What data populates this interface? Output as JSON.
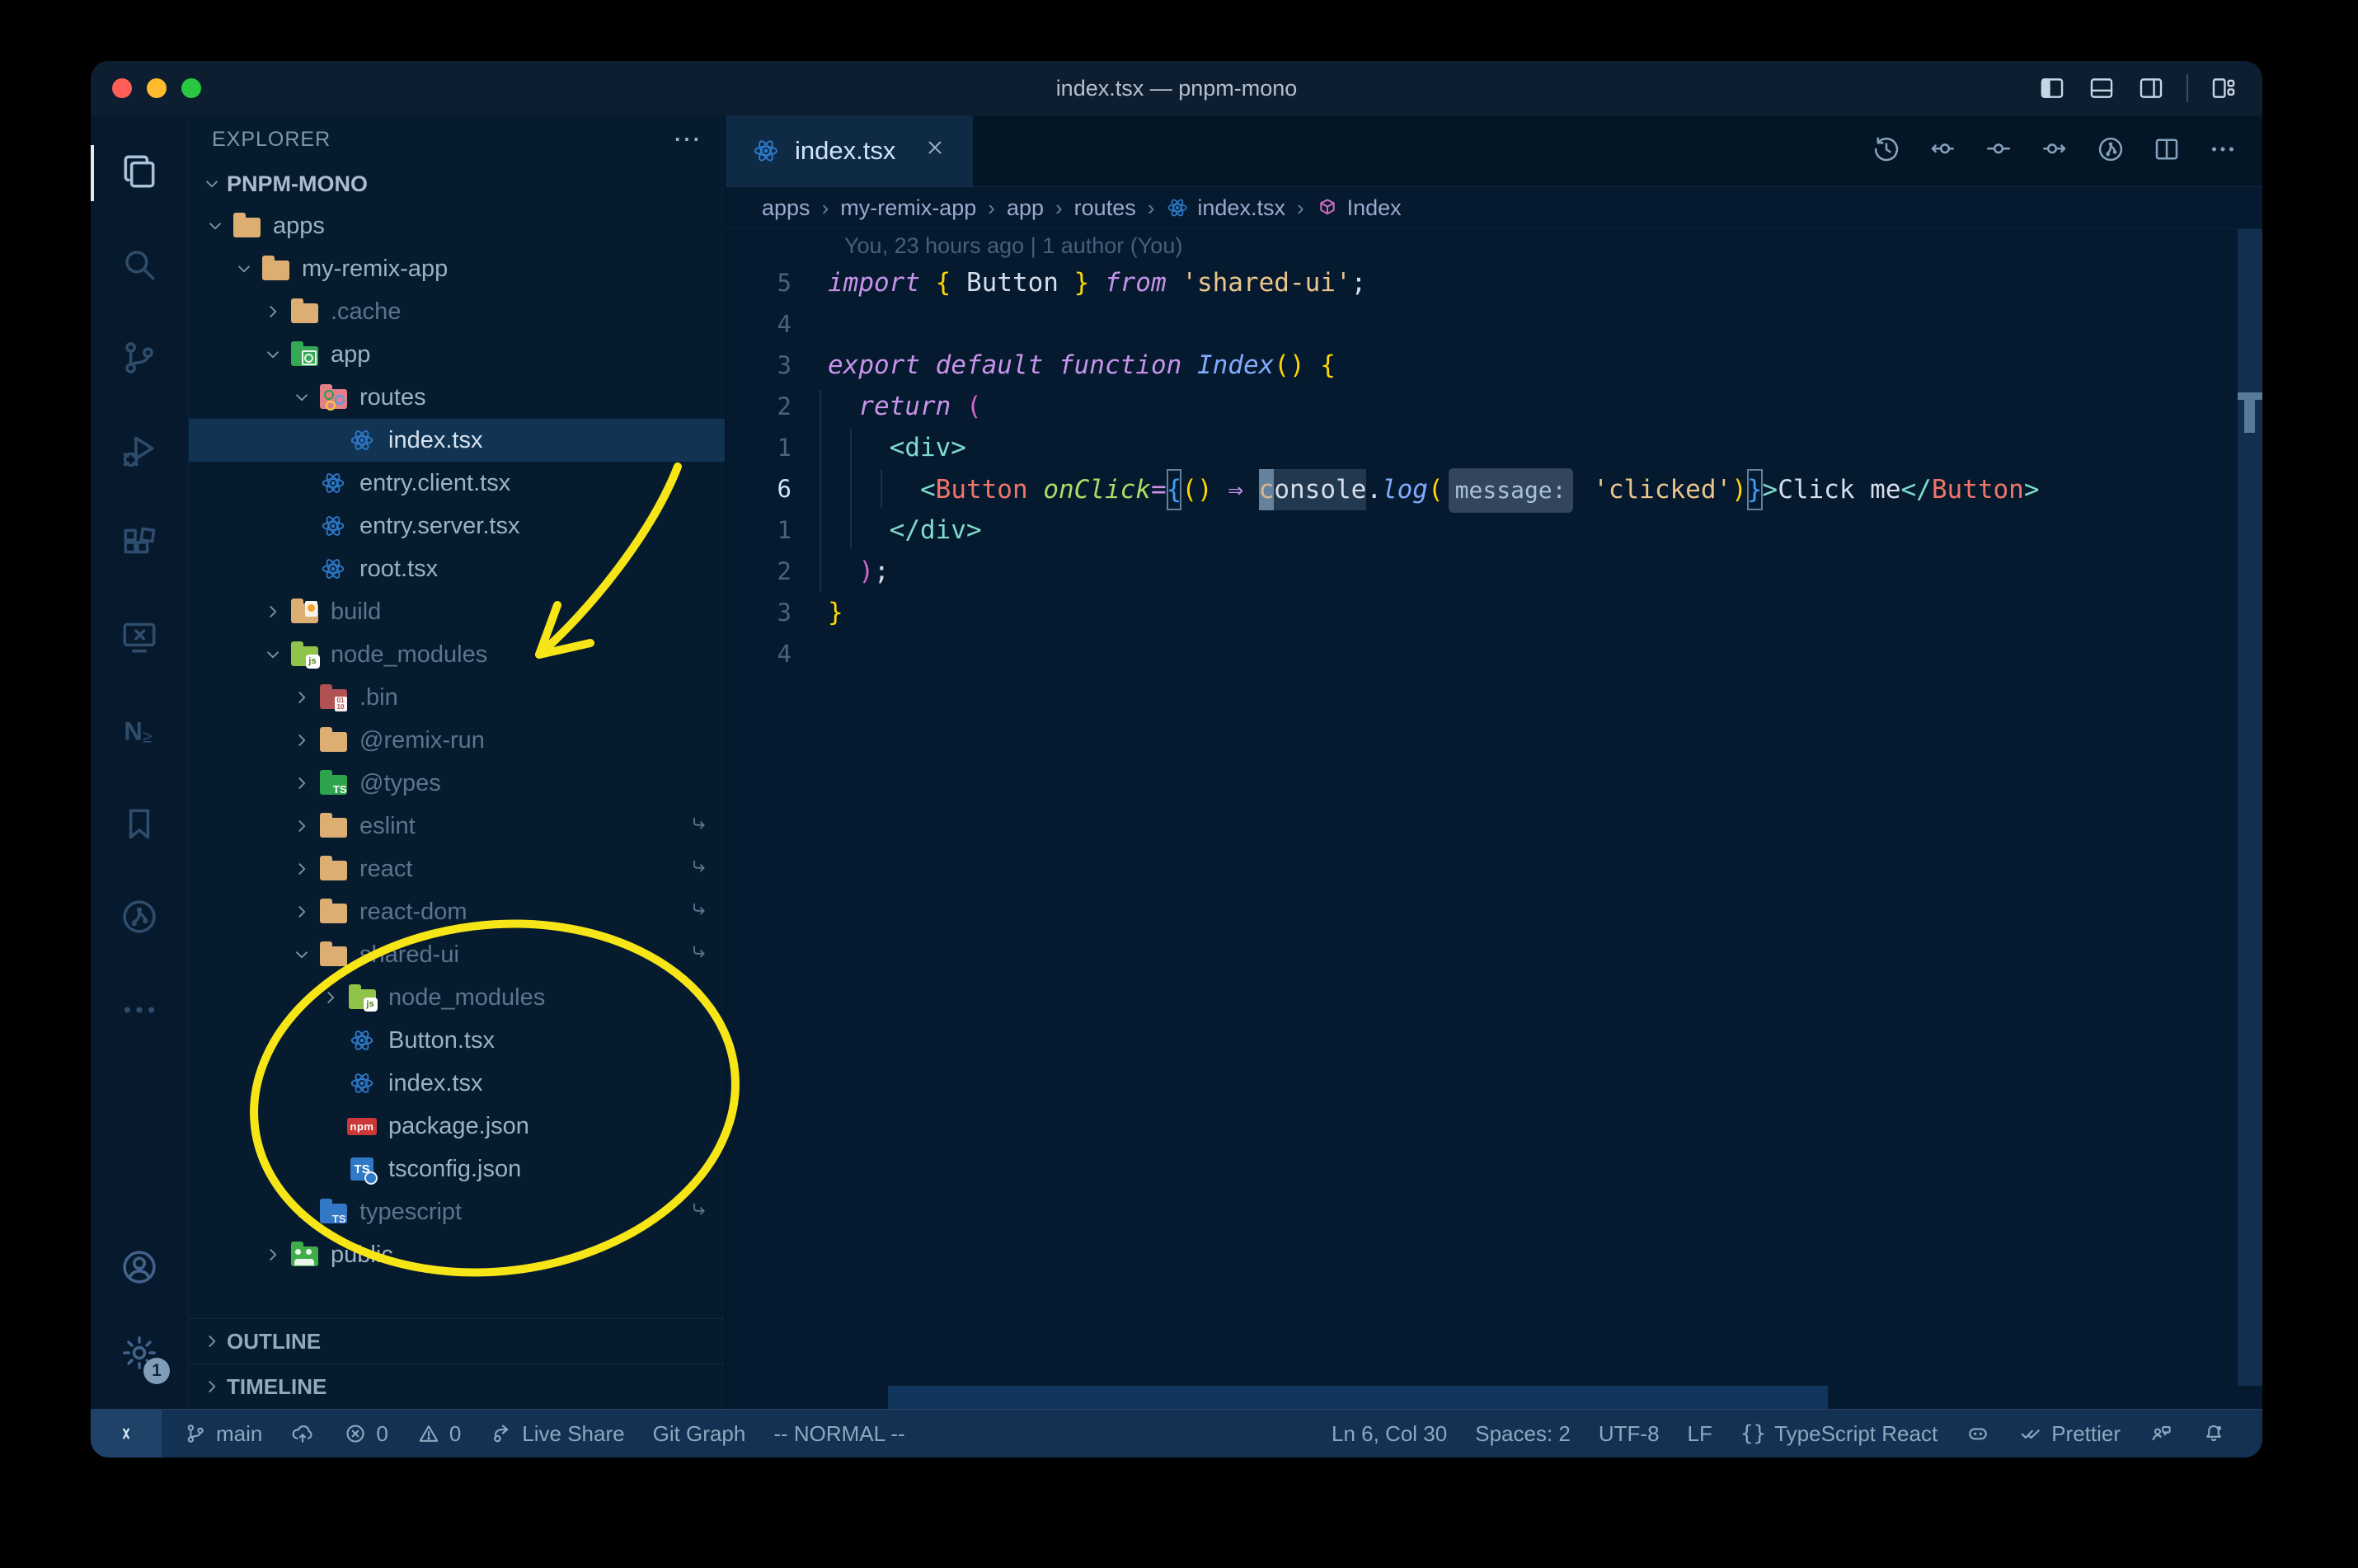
{
  "window": {
    "title": "index.tsx — pnpm-mono"
  },
  "titlebar": {
    "layout_icons": [
      "layout-sidebar-left",
      "layout-panel-bottom",
      "layout-sidebar-right",
      "layout-customize"
    ]
  },
  "activity_bar": {
    "items": [
      {
        "name": "explorer",
        "icon": "files",
        "active": true
      },
      {
        "name": "search",
        "icon": "search",
        "active": false
      },
      {
        "name": "source-control",
        "icon": "scm",
        "active": false
      },
      {
        "name": "run-debug",
        "icon": "debug",
        "active": false
      },
      {
        "name": "extensions",
        "icon": "extensions",
        "active": false
      },
      {
        "name": "remote-explorer",
        "icon": "remote",
        "active": false
      },
      {
        "name": "nx-console",
        "icon": "nx",
        "active": false
      },
      {
        "name": "bookmarks",
        "icon": "bookmark",
        "active": false
      },
      {
        "name": "git-graph",
        "icon": "gitgraph",
        "active": false
      },
      {
        "name": "more-views",
        "icon": "more",
        "active": false
      }
    ],
    "bottom": [
      {
        "name": "account",
        "icon": "account"
      },
      {
        "name": "settings",
        "icon": "gear",
        "badge": "1"
      }
    ]
  },
  "sidebar": {
    "header": "EXPLORER",
    "header_more": "⋯",
    "section": "PNPM-MONO",
    "tree": [
      {
        "label": "apps",
        "level": 1,
        "chevron": "down",
        "icon": "folder-tan",
        "dim": false
      },
      {
        "label": "my-remix-app",
        "level": 2,
        "chevron": "down",
        "icon": "folder-tan",
        "dim": false
      },
      {
        "label": ".cache",
        "level": 3,
        "chevron": "right",
        "icon": "folder-tan",
        "dim": true
      },
      {
        "label": "app",
        "level": 3,
        "chevron": "down",
        "icon": "folder-app",
        "dim": false
      },
      {
        "label": "routes",
        "level": 4,
        "chevron": "down",
        "icon": "folder-routes",
        "dim": false
      },
      {
        "label": "index.tsx",
        "level": 5,
        "chevron": null,
        "icon": "react",
        "dim": false,
        "selected": true
      },
      {
        "label": "entry.client.tsx",
        "level": 4,
        "chevron": null,
        "icon": "react",
        "dim": false
      },
      {
        "label": "entry.server.tsx",
        "level": 4,
        "chevron": null,
        "icon": "react",
        "dim": false
      },
      {
        "label": "root.tsx",
        "level": 4,
        "chevron": null,
        "icon": "react",
        "dim": false
      },
      {
        "label": "build",
        "level": 3,
        "chevron": "right",
        "icon": "folder-build",
        "dim": true
      },
      {
        "label": "node_modules",
        "level": 3,
        "chevron": "down",
        "icon": "folder-node",
        "dim": true
      },
      {
        "label": ".bin",
        "level": 4,
        "chevron": "right",
        "icon": "folder-bin",
        "dim": true
      },
      {
        "label": "@remix-run",
        "level": 4,
        "chevron": "right",
        "icon": "folder-tan",
        "dim": true
      },
      {
        "label": "@types",
        "level": 4,
        "chevron": "right",
        "icon": "folder-types",
        "dim": true
      },
      {
        "label": "eslint",
        "level": 4,
        "chevron": "right",
        "icon": "folder-tan",
        "dim": true,
        "symlink": true
      },
      {
        "label": "react",
        "level": 4,
        "chevron": "right",
        "icon": "folder-tan",
        "dim": true,
        "symlink": true
      },
      {
        "label": "react-dom",
        "level": 4,
        "chevron": "right",
        "icon": "folder-tan",
        "dim": true,
        "symlink": true
      },
      {
        "label": "shared-ui",
        "level": 4,
        "chevron": "down",
        "icon": "folder-tan",
        "dim": true,
        "symlink": true
      },
      {
        "label": "node_modules",
        "level": 5,
        "chevron": "right",
        "icon": "folder-node",
        "dim": true
      },
      {
        "label": "Button.tsx",
        "level": 5,
        "chevron": null,
        "icon": "react",
        "dim": false
      },
      {
        "label": "index.tsx",
        "level": 5,
        "chevron": null,
        "icon": "react",
        "dim": false
      },
      {
        "label": "package.json",
        "level": 5,
        "chevron": null,
        "icon": "npm",
        "dim": false
      },
      {
        "label": "tsconfig.json",
        "level": 5,
        "chevron": null,
        "icon": "tsconfig",
        "dim": false
      },
      {
        "label": "typescript",
        "level": 4,
        "chevron": "right",
        "icon": "folder-ts",
        "dim": true,
        "symlink": true
      },
      {
        "label": "public",
        "level": 3,
        "chevron": "right",
        "icon": "folder-public",
        "dim": false
      }
    ],
    "bottom_sections": [
      "OUTLINE",
      "TIMELINE"
    ]
  },
  "editor": {
    "tab": {
      "label": "index.tsx",
      "icon": "react"
    },
    "actions": [
      "history",
      "prev-change",
      "current-change",
      "next-change",
      "gitlens",
      "split-editor",
      "more"
    ],
    "breadcrumbs": [
      {
        "label": "apps"
      },
      {
        "label": "my-remix-app"
      },
      {
        "label": "app"
      },
      {
        "label": "routes"
      },
      {
        "label": "index.tsx",
        "icon": "react"
      },
      {
        "label": "Index",
        "icon": "symbol-cube"
      }
    ],
    "blame": "You, 23 hours ago | 1 author (You)",
    "lines": [
      {
        "num": "5",
        "tokens": [
          {
            "t": "import",
            "c": "kw"
          },
          {
            "t": " ",
            "c": "plain"
          },
          {
            "t": "{",
            "c": "p1"
          },
          {
            "t": " Button ",
            "c": "plain"
          },
          {
            "t": "}",
            "c": "p1"
          },
          {
            "t": " ",
            "c": "plain"
          },
          {
            "t": "from",
            "c": "kw"
          },
          {
            "t": " ",
            "c": "plain"
          },
          {
            "t": "'shared-ui'",
            "c": "str"
          },
          {
            "t": ";",
            "c": "plain"
          }
        ]
      },
      {
        "num": "4",
        "tokens": []
      },
      {
        "num": "3",
        "tokens": [
          {
            "t": "export",
            "c": "kw"
          },
          {
            "t": " ",
            "c": "plain"
          },
          {
            "t": "default",
            "c": "kw"
          },
          {
            "t": " ",
            "c": "plain"
          },
          {
            "t": "function",
            "c": "kw"
          },
          {
            "t": " ",
            "c": "plain"
          },
          {
            "t": "Index",
            "c": "fn"
          },
          {
            "t": "()",
            "c": "p1"
          },
          {
            "t": " ",
            "c": "plain"
          },
          {
            "t": "{",
            "c": "p1"
          }
        ]
      },
      {
        "num": "2",
        "tokens": [
          {
            "t": "  ",
            "c": "plain"
          },
          {
            "t": "return",
            "c": "kw"
          },
          {
            "t": " ",
            "c": "plain"
          },
          {
            "t": "(",
            "c": "p2"
          }
        ]
      },
      {
        "num": "1",
        "tokens": [
          {
            "t": "    ",
            "c": "plain"
          },
          {
            "t": "<div>",
            "c": "tag"
          }
        ]
      },
      {
        "num": "6",
        "active": true,
        "tokens": [
          {
            "t": "      ",
            "c": "plain"
          },
          {
            "t": "<",
            "c": "tag"
          },
          {
            "t": "Button",
            "c": "jsx"
          },
          {
            "t": " ",
            "c": "plain"
          },
          {
            "t": "onClick",
            "c": "attr"
          },
          {
            "t": "=",
            "c": "kw2"
          },
          {
            "t": "{",
            "c": "p3",
            "box": true
          },
          {
            "t": "()",
            "c": "p1"
          },
          {
            "t": " ",
            "c": "plain"
          },
          {
            "t": "⇒",
            "c": "kw2"
          },
          {
            "t": " ",
            "c": "plain"
          },
          {
            "t": "c",
            "c": "plain",
            "cursor": true
          },
          {
            "t": "onsole",
            "c": "plain",
            "hl": true
          },
          {
            "t": ".",
            "c": "plain"
          },
          {
            "t": "log",
            "c": "fn"
          },
          {
            "t": "(",
            "c": "p1"
          },
          {
            "t": "message:",
            "c": "inlay"
          },
          {
            "t": " ",
            "c": "plain"
          },
          {
            "t": "'clicked'",
            "c": "str"
          },
          {
            "t": ")",
            "c": "p1"
          },
          {
            "t": "}",
            "c": "p3",
            "box": true
          },
          {
            "t": ">",
            "c": "tag"
          },
          {
            "t": "Click me",
            "c": "plain"
          },
          {
            "t": "</",
            "c": "tag"
          },
          {
            "t": "Button",
            "c": "jsx"
          },
          {
            "t": ">",
            "c": "tag"
          }
        ]
      },
      {
        "num": "1",
        "tokens": [
          {
            "t": "    ",
            "c": "plain"
          },
          {
            "t": "</div>",
            "c": "tag"
          }
        ]
      },
      {
        "num": "2",
        "tokens": [
          {
            "t": "  ",
            "c": "plain"
          },
          {
            "t": ")",
            "c": "p2"
          },
          {
            "t": ";",
            "c": "plain"
          }
        ]
      },
      {
        "num": "3",
        "tokens": [
          {
            "t": "}",
            "c": "p1"
          }
        ]
      },
      {
        "num": "4",
        "tokens": []
      }
    ]
  },
  "status_bar": {
    "left": [
      {
        "name": "remote",
        "icon": "remote-status",
        "label": "",
        "boxed": true
      },
      {
        "name": "git-branch",
        "icon": "branch",
        "label": "main"
      },
      {
        "name": "publish",
        "icon": "cloud-upload",
        "label": ""
      },
      {
        "name": "errors",
        "icon": "error",
        "label": "0"
      },
      {
        "name": "warnings",
        "icon": "warning",
        "label": "0"
      },
      {
        "name": "live-share",
        "icon": "liveshare",
        "label": "Live Share"
      },
      {
        "name": "git-graph",
        "icon": null,
        "label": "Git Graph"
      },
      {
        "name": "vim-mode",
        "icon": null,
        "label": "-- NORMAL --"
      }
    ],
    "right": [
      {
        "name": "cursor-position",
        "icon": null,
        "label": "Ln 6, Col 30"
      },
      {
        "name": "indentation",
        "icon": null,
        "label": "Spaces: 2"
      },
      {
        "name": "encoding",
        "icon": null,
        "label": "UTF-8"
      },
      {
        "name": "eol",
        "icon": null,
        "label": "LF"
      },
      {
        "name": "language-mode",
        "icon": "brackets",
        "label": "TypeScript React"
      },
      {
        "name": "copilot",
        "icon": "copilot",
        "label": ""
      },
      {
        "name": "prettier",
        "icon": "prettier",
        "label": "Prettier"
      },
      {
        "name": "feedback",
        "icon": "feedback",
        "label": ""
      },
      {
        "name": "notifications",
        "icon": "bell-dot",
        "label": ""
      }
    ]
  },
  "annotations": {
    "color": "#f6e517",
    "arrow_target": "node_modules folder in explorer",
    "circle_target": "shared-ui package contents in explorer"
  },
  "colors": {
    "traffic_red": "#ff5f57",
    "traffic_yellow": "#febc2e",
    "traffic_green": "#28c840",
    "editor_bg": "#051a2e",
    "sidebar_bg": "#071b2f",
    "statusbar_bg": "#133253",
    "folder_tan": "#dcae72",
    "folder_green": "#35a854",
    "folder_lime": "#8fc34a",
    "folder_routes": "#e2808a",
    "folder_maroon": "#b05252",
    "folder_blue": "#3178c6",
    "react_blue": "#2d79c7",
    "npm_red": "#cb3837",
    "accent_yellow": "#f6e517"
  }
}
